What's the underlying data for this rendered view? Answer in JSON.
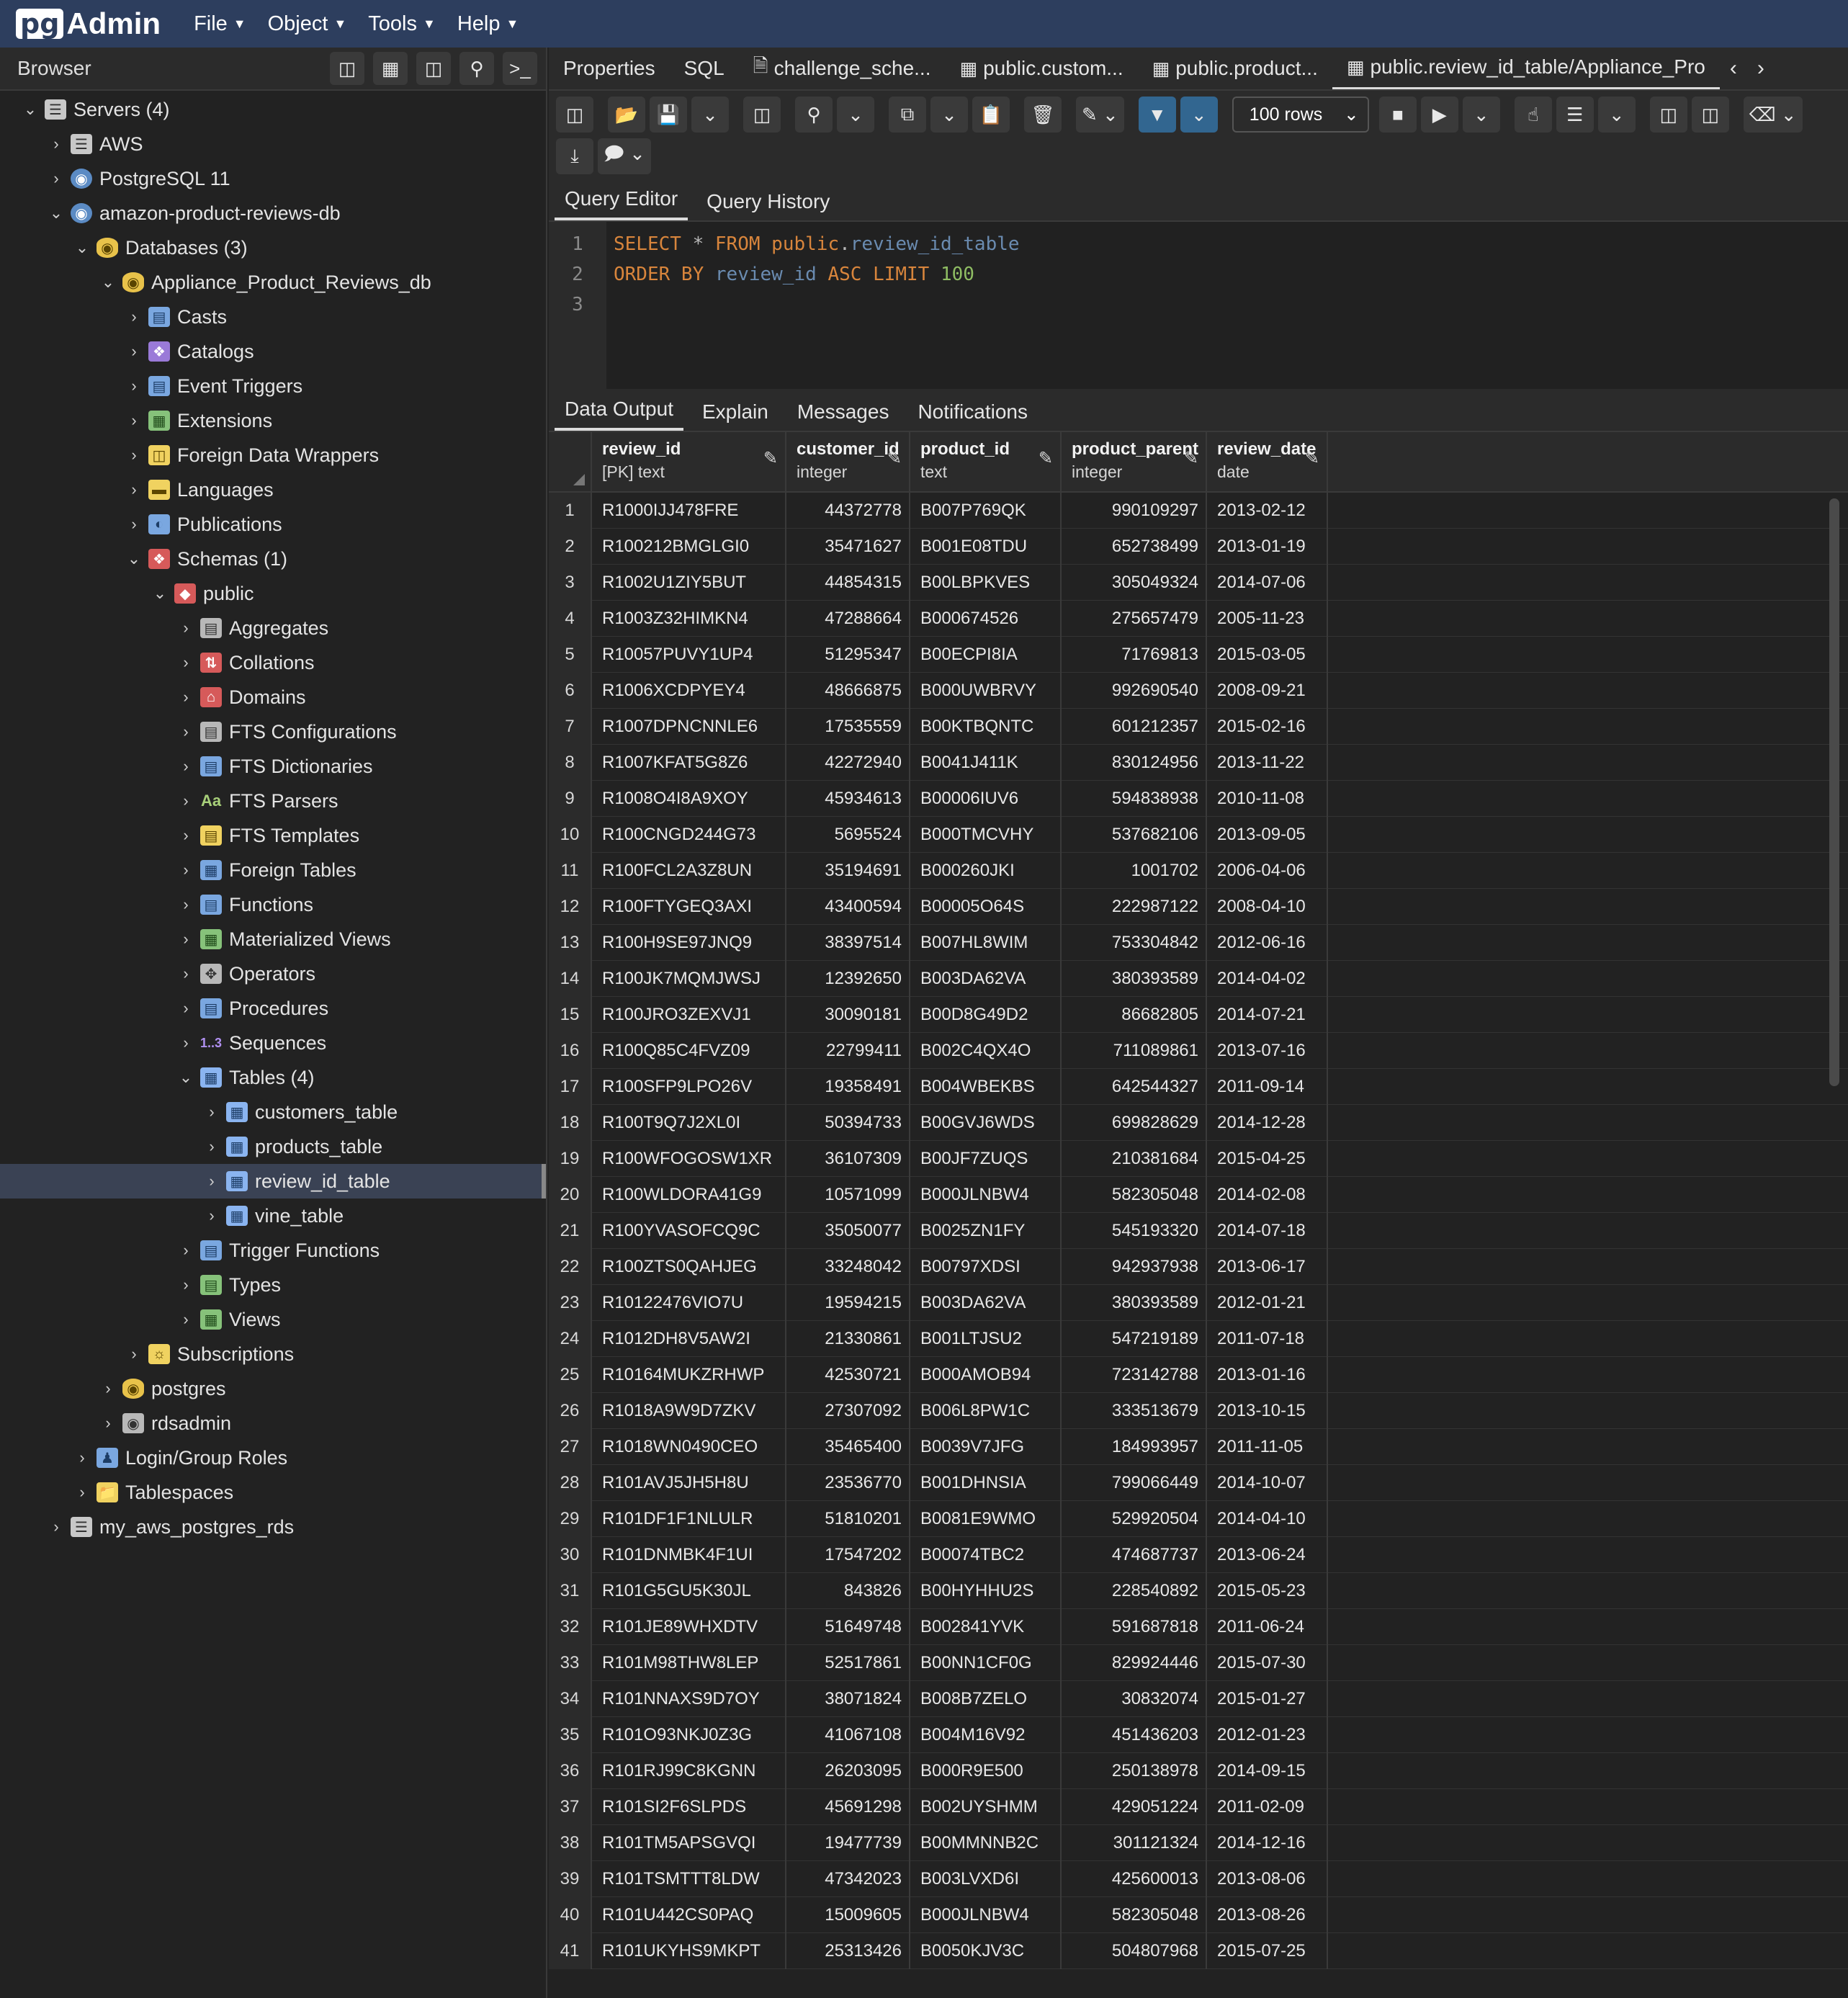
{
  "app": {
    "logo_pg": "pg",
    "logo_admin": "Admin",
    "menu": [
      "File",
      "Object",
      "Tools",
      "Help"
    ]
  },
  "browser": {
    "title": "Browser",
    "tree": [
      {
        "label": "Servers (4)",
        "depth": 0,
        "toggle": "open",
        "icon": "servers-icon"
      },
      {
        "label": "AWS",
        "depth": 1,
        "toggle": "closed",
        "icon": "server-icon"
      },
      {
        "label": "PostgreSQL 11",
        "depth": 1,
        "toggle": "closed",
        "icon": "postgres-server-icon"
      },
      {
        "label": "amazon-product-reviews-db",
        "depth": 1,
        "toggle": "open",
        "icon": "postgres-server-icon"
      },
      {
        "label": "Databases (3)",
        "depth": 2,
        "toggle": "open",
        "icon": "databases-icon"
      },
      {
        "label": "Appliance_Product_Reviews_db",
        "depth": 3,
        "toggle": "open",
        "icon": "database-icon"
      },
      {
        "label": "Casts",
        "depth": 4,
        "toggle": "closed",
        "icon": "casts-icon"
      },
      {
        "label": "Catalogs",
        "depth": 4,
        "toggle": "closed",
        "icon": "catalogs-icon"
      },
      {
        "label": "Event Triggers",
        "depth": 4,
        "toggle": "closed",
        "icon": "event-triggers-icon"
      },
      {
        "label": "Extensions",
        "depth": 4,
        "toggle": "closed",
        "icon": "extensions-icon"
      },
      {
        "label": "Foreign Data Wrappers",
        "depth": 4,
        "toggle": "closed",
        "icon": "foreign-data-wrappers-icon"
      },
      {
        "label": "Languages",
        "depth": 4,
        "toggle": "closed",
        "icon": "languages-icon"
      },
      {
        "label": "Publications",
        "depth": 4,
        "toggle": "closed",
        "icon": "publications-icon"
      },
      {
        "label": "Schemas (1)",
        "depth": 4,
        "toggle": "open",
        "icon": "schemas-icon"
      },
      {
        "label": "public",
        "depth": 5,
        "toggle": "open",
        "icon": "schema-icon"
      },
      {
        "label": "Aggregates",
        "depth": 6,
        "toggle": "closed",
        "icon": "aggregates-icon"
      },
      {
        "label": "Collations",
        "depth": 6,
        "toggle": "closed",
        "icon": "collations-icon"
      },
      {
        "label": "Domains",
        "depth": 6,
        "toggle": "closed",
        "icon": "domains-icon"
      },
      {
        "label": "FTS Configurations",
        "depth": 6,
        "toggle": "closed",
        "icon": "fts-configurations-icon"
      },
      {
        "label": "FTS Dictionaries",
        "depth": 6,
        "toggle": "closed",
        "icon": "fts-dictionaries-icon"
      },
      {
        "label": "FTS Parsers",
        "depth": 6,
        "toggle": "closed",
        "icon": "fts-parsers-icon"
      },
      {
        "label": "FTS Templates",
        "depth": 6,
        "toggle": "closed",
        "icon": "fts-templates-icon"
      },
      {
        "label": "Foreign Tables",
        "depth": 6,
        "toggle": "closed",
        "icon": "foreign-tables-icon"
      },
      {
        "label": "Functions",
        "depth": 6,
        "toggle": "closed",
        "icon": "functions-icon"
      },
      {
        "label": "Materialized Views",
        "depth": 6,
        "toggle": "closed",
        "icon": "materialized-views-icon"
      },
      {
        "label": "Operators",
        "depth": 6,
        "toggle": "closed",
        "icon": "operators-icon"
      },
      {
        "label": "Procedures",
        "depth": 6,
        "toggle": "closed",
        "icon": "procedures-icon"
      },
      {
        "label": "Sequences",
        "depth": 6,
        "toggle": "closed",
        "icon": "sequences-icon"
      },
      {
        "label": "Tables (4)",
        "depth": 6,
        "toggle": "open",
        "icon": "tables-icon"
      },
      {
        "label": "customers_table",
        "depth": 7,
        "toggle": "closed",
        "icon": "table-icon"
      },
      {
        "label": "products_table",
        "depth": 7,
        "toggle": "closed",
        "icon": "table-icon"
      },
      {
        "label": "review_id_table",
        "depth": 7,
        "toggle": "closed",
        "icon": "table-icon",
        "selected": true
      },
      {
        "label": "vine_table",
        "depth": 7,
        "toggle": "closed",
        "icon": "table-icon"
      },
      {
        "label": "Trigger Functions",
        "depth": 6,
        "toggle": "closed",
        "icon": "trigger-functions-icon"
      },
      {
        "label": "Types",
        "depth": 6,
        "toggle": "closed",
        "icon": "types-icon"
      },
      {
        "label": "Views",
        "depth": 6,
        "toggle": "closed",
        "icon": "views-icon"
      },
      {
        "label": "Subscriptions",
        "depth": 4,
        "toggle": "closed",
        "icon": "subscriptions-icon"
      },
      {
        "label": "postgres",
        "depth": 3,
        "toggle": "closed",
        "icon": "database-icon"
      },
      {
        "label": "rdsadmin",
        "depth": 3,
        "toggle": "closed",
        "icon": "database-disconnected-icon"
      },
      {
        "label": "Login/Group Roles",
        "depth": 2,
        "toggle": "closed",
        "icon": "login-roles-icon"
      },
      {
        "label": "Tablespaces",
        "depth": 2,
        "toggle": "closed",
        "icon": "tablespaces-icon"
      },
      {
        "label": "my_aws_postgres_rds",
        "depth": 1,
        "toggle": "closed",
        "icon": "server-disconnected-icon"
      }
    ]
  },
  "tabs": [
    {
      "label": "Properties",
      "icon": ""
    },
    {
      "label": "SQL",
      "icon": ""
    },
    {
      "label": "challenge_sche...",
      "icon": "file-icon"
    },
    {
      "label": "public.custom...",
      "icon": "table-icon"
    },
    {
      "label": "public.product...",
      "icon": "table-icon"
    },
    {
      "label": "public.review_id_table/Appliance_Pro",
      "icon": "table-icon",
      "active": true
    }
  ],
  "toolbar": {
    "rows_select": "100 rows"
  },
  "editor": {
    "tabs": [
      "Query Editor",
      "Query History"
    ],
    "line_numbers": [
      "1",
      "2",
      "3"
    ]
  },
  "output": {
    "tabs": [
      "Data Output",
      "Explain",
      "Messages",
      "Notifications"
    ],
    "columns": [
      {
        "name": "review_id",
        "type": "[PK] text"
      },
      {
        "name": "customer_id",
        "type": "integer"
      },
      {
        "name": "product_id",
        "type": "text"
      },
      {
        "name": "product_parent",
        "type": "integer"
      },
      {
        "name": "review_date",
        "type": "date"
      }
    ],
    "rows": [
      [
        "1",
        "R1000IJJ478FRE",
        "44372778",
        "B007P769QK",
        "990109297",
        "2013-02-12"
      ],
      [
        "2",
        "R100212BMGLGI0",
        "35471627",
        "B001E08TDU",
        "652738499",
        "2013-01-19"
      ],
      [
        "3",
        "R1002U1ZIY5BUT",
        "44854315",
        "B00LBPKVES",
        "305049324",
        "2014-07-06"
      ],
      [
        "4",
        "R1003Z32HIMKN4",
        "47288664",
        "B000674526",
        "275657479",
        "2005-11-23"
      ],
      [
        "5",
        "R10057PUVY1UP4",
        "51295347",
        "B00ECPI8IA",
        "71769813",
        "2015-03-05"
      ],
      [
        "6",
        "R1006XCDPYEY4",
        "48666875",
        "B000UWBRVY",
        "992690540",
        "2008-09-21"
      ],
      [
        "7",
        "R1007DPNCNNLE6",
        "17535559",
        "B00KTBQNTC",
        "601212357",
        "2015-02-16"
      ],
      [
        "8",
        "R1007KFAT5G8Z6",
        "42272940",
        "B0041J411K",
        "830124956",
        "2013-11-22"
      ],
      [
        "9",
        "R1008O4I8A9XOY",
        "45934613",
        "B00006IUV6",
        "594838938",
        "2010-11-08"
      ],
      [
        "10",
        "R100CNGD244G73",
        "5695524",
        "B000TMCVHY",
        "537682106",
        "2013-09-05"
      ],
      [
        "11",
        "R100FCL2A3Z8UN",
        "35194691",
        "B000260JKI",
        "1001702",
        "2006-04-06"
      ],
      [
        "12",
        "R100FTYGEQ3AXI",
        "43400594",
        "B00005O64S",
        "222987122",
        "2008-04-10"
      ],
      [
        "13",
        "R100H9SE97JNQ9",
        "38397514",
        "B007HL8WIM",
        "753304842",
        "2012-06-16"
      ],
      [
        "14",
        "R100JK7MQMJWSJ",
        "12392650",
        "B003DA62VA",
        "380393589",
        "2014-04-02"
      ],
      [
        "15",
        "R100JRO3ZEXVJ1",
        "30090181",
        "B00D8G49D2",
        "86682805",
        "2014-07-21"
      ],
      [
        "16",
        "R100Q85C4FVZ09",
        "22799411",
        "B002C4QX4O",
        "711089861",
        "2013-07-16"
      ],
      [
        "17",
        "R100SFP9LPO26V",
        "19358491",
        "B004WBEKBS",
        "642544327",
        "2011-09-14"
      ],
      [
        "18",
        "R100T9Q7J2XL0I",
        "50394733",
        "B00GVJ6WDS",
        "699828629",
        "2014-12-28"
      ],
      [
        "19",
        "R100WFOGOSW1XR",
        "36107309",
        "B00JF7ZUQS",
        "210381684",
        "2015-04-25"
      ],
      [
        "20",
        "R100WLDORA41G9",
        "10571099",
        "B000JLNBW4",
        "582305048",
        "2014-02-08"
      ],
      [
        "21",
        "R100YVASOFCQ9C",
        "35050077",
        "B0025ZN1FY",
        "545193320",
        "2014-07-18"
      ],
      [
        "22",
        "R100ZTS0QAHJEG",
        "33248042",
        "B00797XDSI",
        "942937938",
        "2013-06-17"
      ],
      [
        "23",
        "R10122476VIO7U",
        "19594215",
        "B003DA62VA",
        "380393589",
        "2012-01-21"
      ],
      [
        "24",
        "R1012DH8V5AW2I",
        "21330861",
        "B001LTJSU2",
        "547219189",
        "2011-07-18"
      ],
      [
        "25",
        "R10164MUKZRHWP",
        "42530721",
        "B000AMOB94",
        "723142788",
        "2013-01-16"
      ],
      [
        "26",
        "R1018A9W9D7ZKV",
        "27307092",
        "B006L8PW1C",
        "333513679",
        "2013-10-15"
      ],
      [
        "27",
        "R1018WN0490CEO",
        "35465400",
        "B0039V7JFG",
        "184993957",
        "2011-11-05"
      ],
      [
        "28",
        "R101AVJ5JH5H8U",
        "23536770",
        "B001DHNSIA",
        "799066449",
        "2014-10-07"
      ],
      [
        "29",
        "R101DF1F1NLULR",
        "51810201",
        "B0081E9WMO",
        "529920504",
        "2014-04-10"
      ],
      [
        "30",
        "R101DNMBK4F1UI",
        "17547202",
        "B00074TBC2",
        "474687737",
        "2013-06-24"
      ],
      [
        "31",
        "R101G5GU5K30JL",
        "843826",
        "B00HYHHU2S",
        "228540892",
        "2015-05-23"
      ],
      [
        "32",
        "R101JE89WHXDTV",
        "51649748",
        "B002841YVK",
        "591687818",
        "2011-06-24"
      ],
      [
        "33",
        "R101M98THW8LEP",
        "52517861",
        "B00NN1CF0G",
        "829924446",
        "2015-07-30"
      ],
      [
        "34",
        "R101NNAXS9D7OY",
        "38071824",
        "B008B7ZELO",
        "30832074",
        "2015-01-27"
      ],
      [
        "35",
        "R101O93NKJ0Z3G",
        "41067108",
        "B004M16V92",
        "451436203",
        "2012-01-23"
      ],
      [
        "36",
        "R101RJ99C8KGNN",
        "26203095",
        "B000R9E500",
        "250138978",
        "2014-09-15"
      ],
      [
        "37",
        "R101SI2F6SLPDS",
        "45691298",
        "B002UYSHMM",
        "429051224",
        "2011-02-09"
      ],
      [
        "38",
        "R101TM5APSGVQI",
        "19477739",
        "B00MMNNB2C",
        "301121324",
        "2014-12-16"
      ],
      [
        "39",
        "R101TSMTTT8LDW",
        "47342023",
        "B003LVXD6I",
        "425600013",
        "2013-08-06"
      ],
      [
        "40",
        "R101U442CS0PAQ",
        "15009605",
        "B000JLNBW4",
        "582305048",
        "2013-08-26"
      ],
      [
        "41",
        "R101UKYHS9MKPT",
        "25313426",
        "B0050KJV3C",
        "504807968",
        "2015-07-25"
      ]
    ]
  }
}
